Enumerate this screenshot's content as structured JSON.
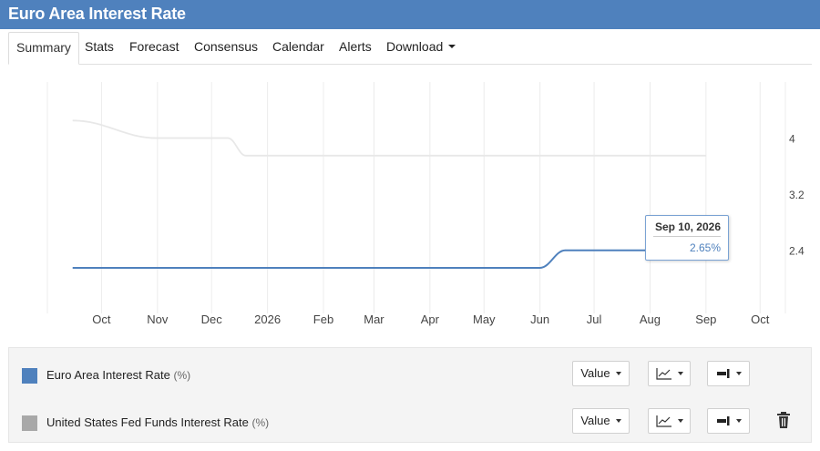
{
  "header": {
    "title": "Euro Area Interest Rate"
  },
  "tabs": [
    {
      "label": "Summary",
      "active": true
    },
    {
      "label": "Stats"
    },
    {
      "label": "Forecast"
    },
    {
      "label": "Consensus"
    },
    {
      "label": "Calendar"
    },
    {
      "label": "Alerts"
    },
    {
      "label": "Download",
      "dropdown": true
    }
  ],
  "chart_data": {
    "type": "line",
    "x_tick_labels": [
      "Oct",
      "Nov",
      "Dec",
      "2026",
      "Feb",
      "Mar",
      "Apr",
      "May",
      "Jun",
      "Jul",
      "Aug",
      "Sep",
      "Oct"
    ],
    "y_tick_labels": [
      "4",
      "3.2",
      "2.4"
    ],
    "ylim": [
      1.5,
      4.8
    ],
    "grid": true,
    "legend": "bottom",
    "series": [
      {
        "name": "Euro Area Interest Rate",
        "unit": "%",
        "color": "#4f81bd",
        "x": [
          "2025-09-15",
          "2026-06-01",
          "2026-06-15",
          "2026-08-26",
          "2026-09-10"
        ],
        "values": [
          2.15,
          2.15,
          2.4,
          2.4,
          2.65
        ]
      },
      {
        "name": "United States Fed Funds Interest Rate",
        "unit": "%",
        "color": "#e8e8e8",
        "x": [
          "2025-09-15",
          "2025-11-01",
          "2025-12-10",
          "2025-12-20",
          "2026-09-01"
        ],
        "values": [
          4.25,
          4.0,
          4.0,
          3.75,
          3.75
        ]
      }
    ],
    "tooltip": {
      "date": "Sep 10, 2026",
      "value": "2.65%"
    }
  },
  "legend": {
    "rows": [
      {
        "label": "Euro Area Interest Rate",
        "unit": "(%)",
        "color": "#4f81bd",
        "value_button": "Value",
        "chart_type_icon": "line-chart-icon",
        "axis_icon": "axis-right-icon"
      },
      {
        "label": "United States Fed Funds Interest Rate",
        "unit": "(%)",
        "color": "#a8a8a8",
        "value_button": "Value",
        "chart_type_icon": "line-chart-icon",
        "axis_icon": "axis-right-icon",
        "delete_icon": "trash-icon"
      }
    ]
  }
}
